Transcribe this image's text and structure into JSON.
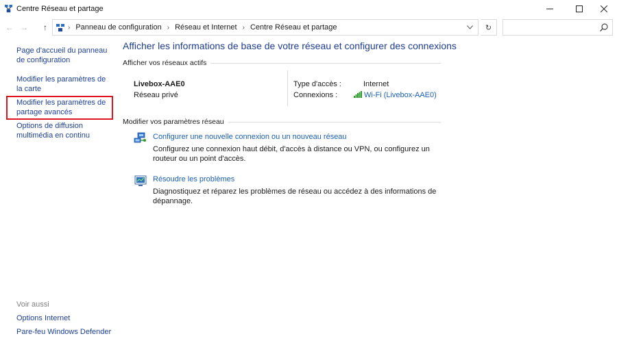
{
  "window": {
    "title": "Centre Réseau et partage",
    "controls": {
      "minimize": "—",
      "maximize": "☐",
      "close": "✕"
    }
  },
  "navigation": {
    "back_glyph": "←",
    "forward_glyph": "→",
    "up_glyph": "↑",
    "breadcrumbs": [
      "Panneau de configuration",
      "Réseau et Internet",
      "Centre Réseau et partage"
    ],
    "separator": "›",
    "dropdown_glyph": "⌄",
    "refresh_glyph": "↻",
    "search_placeholder": ""
  },
  "sidebar": {
    "items": [
      {
        "label": "Page d'accueil du panneau de configuration"
      },
      {
        "label": "Modifier les paramètres de la carte"
      },
      {
        "label": "Modifier les paramètres de partage avancés",
        "highlighted": true
      },
      {
        "label": "Options de diffusion multimédia en continu"
      }
    ],
    "see_also_title": "Voir aussi",
    "see_also": [
      {
        "label": "Options Internet"
      },
      {
        "label": "Pare-feu Windows Defender"
      }
    ],
    "highlight_color": "#e0141e"
  },
  "main": {
    "title": "Afficher les informations de base de votre réseau et configurer des connexions",
    "active_networks_heading": "Afficher vos réseaux actifs",
    "network": {
      "name": "Livebox-AAE0",
      "type": "Réseau privé",
      "access_label": "Type d'accès :",
      "access_value": "Internet",
      "connections_label": "Connexions :",
      "connections_value": "Wi-Fi (Livebox-AAE0)"
    },
    "change_settings_heading": "Modifier vos paramètres réseau",
    "tasks": [
      {
        "icon": "network-setup-icon",
        "link": "Configurer une nouvelle connexion ou un nouveau réseau",
        "description": "Configurez une connexion haut débit, d'accès à distance ou VPN, ou configurez un routeur ou un point d'accès."
      },
      {
        "icon": "troubleshoot-icon",
        "link": "Résoudre les problèmes",
        "description": "Diagnostiquez et réparez les problèmes de réseau ou accédez à des informations de dépannage."
      }
    ]
  },
  "colors": {
    "link": "#1a5fb4",
    "sidebar_link": "#1c3f94",
    "title": "#1e3d8f",
    "wifi_green": "#2e9a2e"
  }
}
